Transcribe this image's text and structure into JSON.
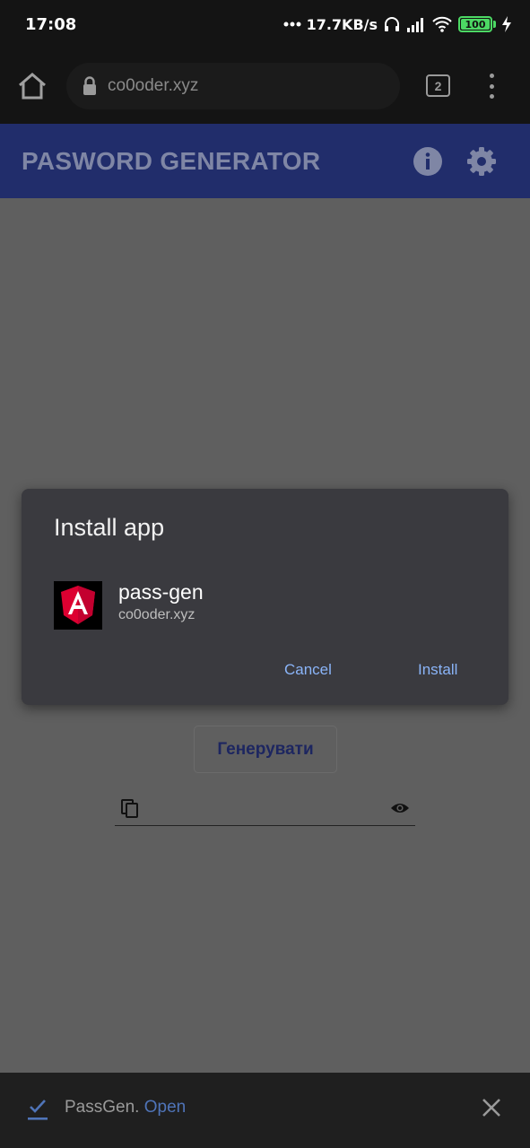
{
  "status_bar": {
    "time": "17:08",
    "network_speed": "17.7KB/s",
    "battery": "100",
    "icons": [
      "dots-icon",
      "headphones-icon",
      "signal-icon",
      "wifi-icon",
      "battery-icon",
      "charging-icon"
    ]
  },
  "browser": {
    "url": "co0oder.xyz",
    "tab_count": "2",
    "icons": [
      "home-icon",
      "lock-icon",
      "tabs-icon",
      "more-vert-icon"
    ]
  },
  "app": {
    "title": "PASWORD GENERATOR",
    "generate_label": "Генерувати",
    "password_value": "",
    "icons": [
      "info-icon",
      "settings-icon",
      "copy-icon",
      "eye-icon"
    ],
    "toolbar_color": "#212d6b"
  },
  "install_dialog": {
    "title": "Install app",
    "app_name": "pass-gen",
    "app_domain": "co0oder.xyz",
    "cancel_label": "Cancel",
    "install_label": "Install",
    "accent": "#8ab4f8",
    "icon": "angular-logo-icon"
  },
  "bottom_bar": {
    "text": "PassGen.",
    "link": "Open",
    "icons": [
      "check-icon",
      "close-icon"
    ]
  }
}
